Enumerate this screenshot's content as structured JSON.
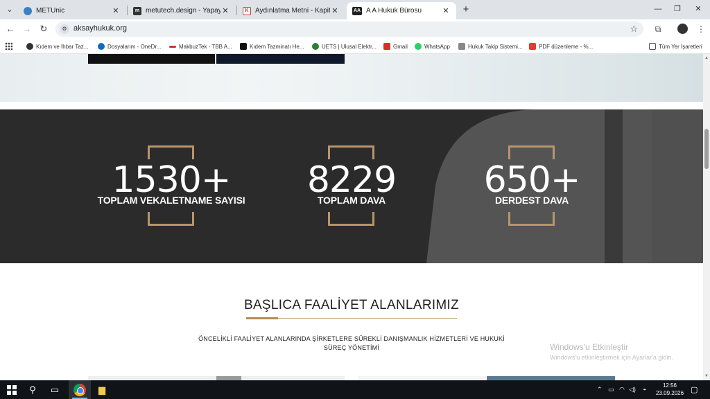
{
  "browser": {
    "tabs": [
      {
        "title": "METUnic",
        "icon": "metu-tab-icon",
        "color": "#3b82c4",
        "active": false
      },
      {
        "title": "metutech.design - Yapay Zeka İ",
        "icon": "metutech-tab-icon",
        "color": "#333333",
        "active": false
      },
      {
        "title": "Aydınlatma Metni - Kapital Leg",
        "icon": "kapital-tab-icon",
        "color": "#c0392b",
        "active": false
      },
      {
        "title": "A A Hukuk Bürosu",
        "icon": "aa-tab-icon",
        "color": "#222222",
        "active": true
      }
    ],
    "url": "aksayhukuk.org",
    "bookmarks": [
      {
        "label": "Kıdem ve İhbar Taz...",
        "icon": "globe-bookmark-icon",
        "color": "#333333"
      },
      {
        "label": "Dosyalarım - OneDr...",
        "icon": "onedrive-bookmark-icon",
        "color": "#0f6cbd"
      },
      {
        "label": "MakbuzTek - TBB A...",
        "icon": "makbuz-bookmark-icon",
        "color": "#c0392b"
      },
      {
        "label": "Kıdem Tazminatı He...",
        "icon": "d-bookmark-icon",
        "color": "#111111"
      },
      {
        "label": "UETS | Ulusal Elektr...",
        "icon": "uets-bookmark-icon",
        "color": "#2e7d32"
      },
      {
        "label": "Gmail",
        "icon": "gmail-bookmark-icon",
        "color": "#d93025"
      },
      {
        "label": "WhatsApp",
        "icon": "whatsapp-bookmark-icon",
        "color": "#25d366"
      },
      {
        "label": "Hukuk Takip Sistemi...",
        "icon": "hukuk-bookmark-icon",
        "color": "#888888"
      },
      {
        "label": "PDF düzenleme - %...",
        "icon": "pdf-bookmark-icon",
        "color": "#e53935"
      }
    ],
    "all_bookmarks": "Tüm Yer İşaretleri"
  },
  "stats": [
    {
      "number": "1530+",
      "label": "TOPLAM VEKALETNAME SAYISI"
    },
    {
      "number": "8229",
      "label": "TOPLAM DAVA"
    },
    {
      "number": "650+",
      "label": "DERDEST DAVA"
    }
  ],
  "section": {
    "title": "BAŞLICA FAALİYET ALANLARIMIZ",
    "subtitle": "ÖNCELİKLİ FAALİYET ALANLARINDA ŞİRKETLERE SÜREKLİ DANIŞMANLIK HİZMETLERİ VE HUKUKİ SÜREÇ YÖNETİMİ"
  },
  "watermark": {
    "title": "Windows'u Etkinleştir",
    "subtitle": "Windows'u etkinleştirmek için Ayarlar'a gidin."
  },
  "taskbar": {
    "time": "12:56",
    "date": "23.09.2026"
  },
  "colors": {
    "accent_gold": "#b8956a",
    "stats_bg": "#2b2b2b"
  }
}
